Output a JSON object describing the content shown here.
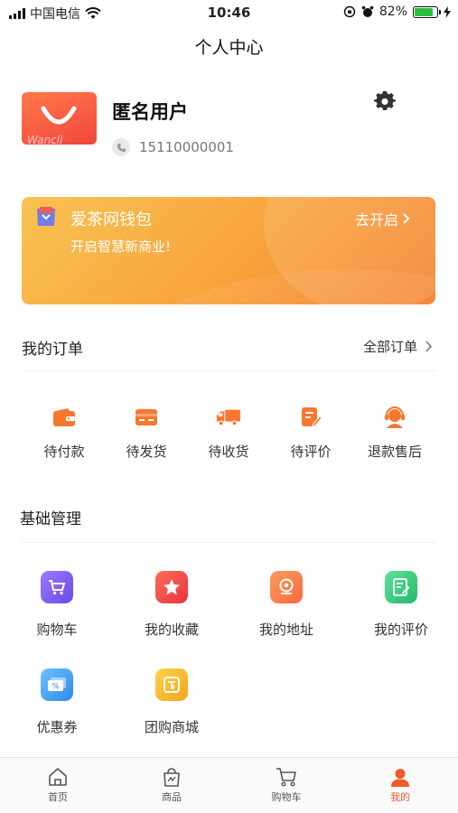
{
  "status_bar": {
    "carrier": "中国电信",
    "time": "10:46",
    "battery": "82%"
  },
  "page_title": "个人中心",
  "profile": {
    "avatar_text": "Wancll",
    "name": "匿名用户",
    "phone": "15110000001"
  },
  "wallet": {
    "title": "爱茶网钱包",
    "subtitle": "开启智慧新商业!",
    "action": "去开启"
  },
  "orders": {
    "title": "我的订单",
    "all_label": "全部订单",
    "items": [
      {
        "label": "待付款",
        "icon": "wallet-icon"
      },
      {
        "label": "待发货",
        "icon": "card-icon"
      },
      {
        "label": "待收货",
        "icon": "truck-icon"
      },
      {
        "label": "待评价",
        "icon": "review-icon"
      },
      {
        "label": "退款售后",
        "icon": "service-icon"
      }
    ]
  },
  "basic": {
    "title": "基础管理",
    "items": [
      {
        "label": "购物车",
        "icon": "cart-icon",
        "color": "#7b5cf0"
      },
      {
        "label": "我的收藏",
        "icon": "star-icon",
        "color": "#f2453d"
      },
      {
        "label": "我的地址",
        "icon": "location-icon",
        "color": "#fb7a45"
      },
      {
        "label": "我的评价",
        "icon": "comment-icon",
        "color": "#2fc77a"
      },
      {
        "label": "优惠券",
        "icon": "coupon-icon",
        "color": "#3d9cf0"
      },
      {
        "label": "团购商城",
        "icon": "group-buy-icon",
        "color": "#f6b82a"
      }
    ]
  },
  "tabbar": {
    "active_color": "#f25a2a",
    "items": [
      {
        "label": "首页",
        "icon": "home-icon"
      },
      {
        "label": "商品",
        "icon": "goods-icon"
      },
      {
        "label": "购物车",
        "icon": "cart-icon"
      },
      {
        "label": "我的",
        "icon": "user-icon"
      }
    ]
  },
  "colors": {
    "accent": "#f8772f",
    "wallet_gradient_start": "#f9c352",
    "wallet_gradient_end": "#f47f2b"
  }
}
